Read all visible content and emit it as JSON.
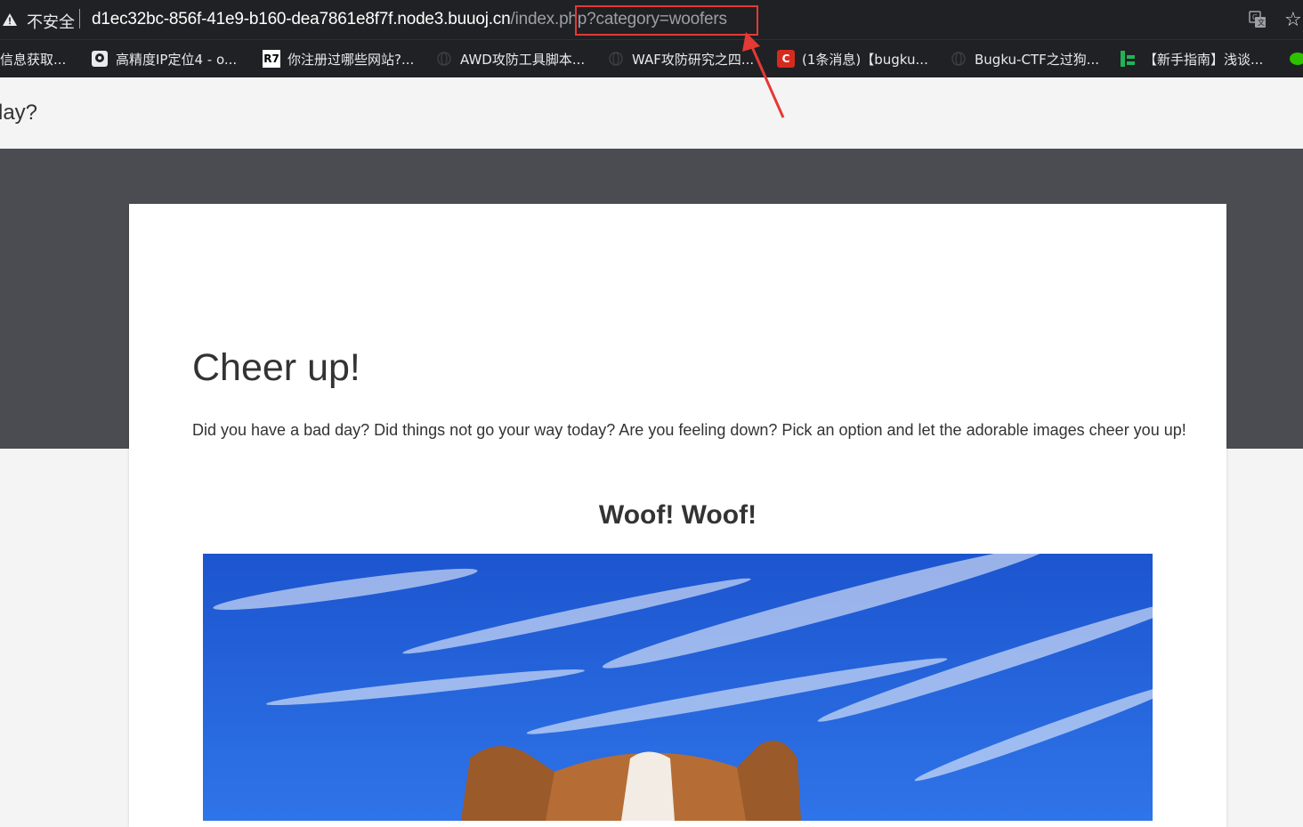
{
  "browser": {
    "security_label": "不安全",
    "url_host": "d1ec32bc-856f-41e9-b160-dea7861e8f7f.node3.buuoj.cn",
    "url_path": "/index.php?category=woofers",
    "highlight_color": "#e53935"
  },
  "bookmarks": [
    {
      "label": "信息获取...",
      "icon": "page-icon"
    },
    {
      "label": "高精度IP定位4 - o...",
      "icon": "ip-locator-icon"
    },
    {
      "label": "你注册过哪些网站?...",
      "icon": "r7-icon",
      "icon_text": "R7"
    },
    {
      "label": "AWD攻防工具脚本...",
      "icon": "globe-icon"
    },
    {
      "label": "WAF攻防研究之四...",
      "icon": "globe-icon"
    },
    {
      "label": "(1条消息)【bugku...",
      "icon": "csdn-icon",
      "icon_text": "C"
    },
    {
      "label": "Bugku-CTF之过狗...",
      "icon": "globe-icon"
    },
    {
      "label": "【新手指南】浅谈...",
      "icon": "green-bars-icon"
    }
  ],
  "page": {
    "nav_brand": "lay?",
    "heading": "Cheer up!",
    "lead": "Did you have a bad day? Did things not go your way today? Are you feeling down? Pick an option and let the adorable images cheer you up!",
    "subheading": "Woof! Woof!",
    "image_subject": "corgi-dog-under-blue-sky"
  },
  "colors": {
    "chrome_bg": "#202124",
    "hero_bg": "#4b4c51",
    "page_bg": "#f4f4f4",
    "sky": "#1d5bd6"
  }
}
